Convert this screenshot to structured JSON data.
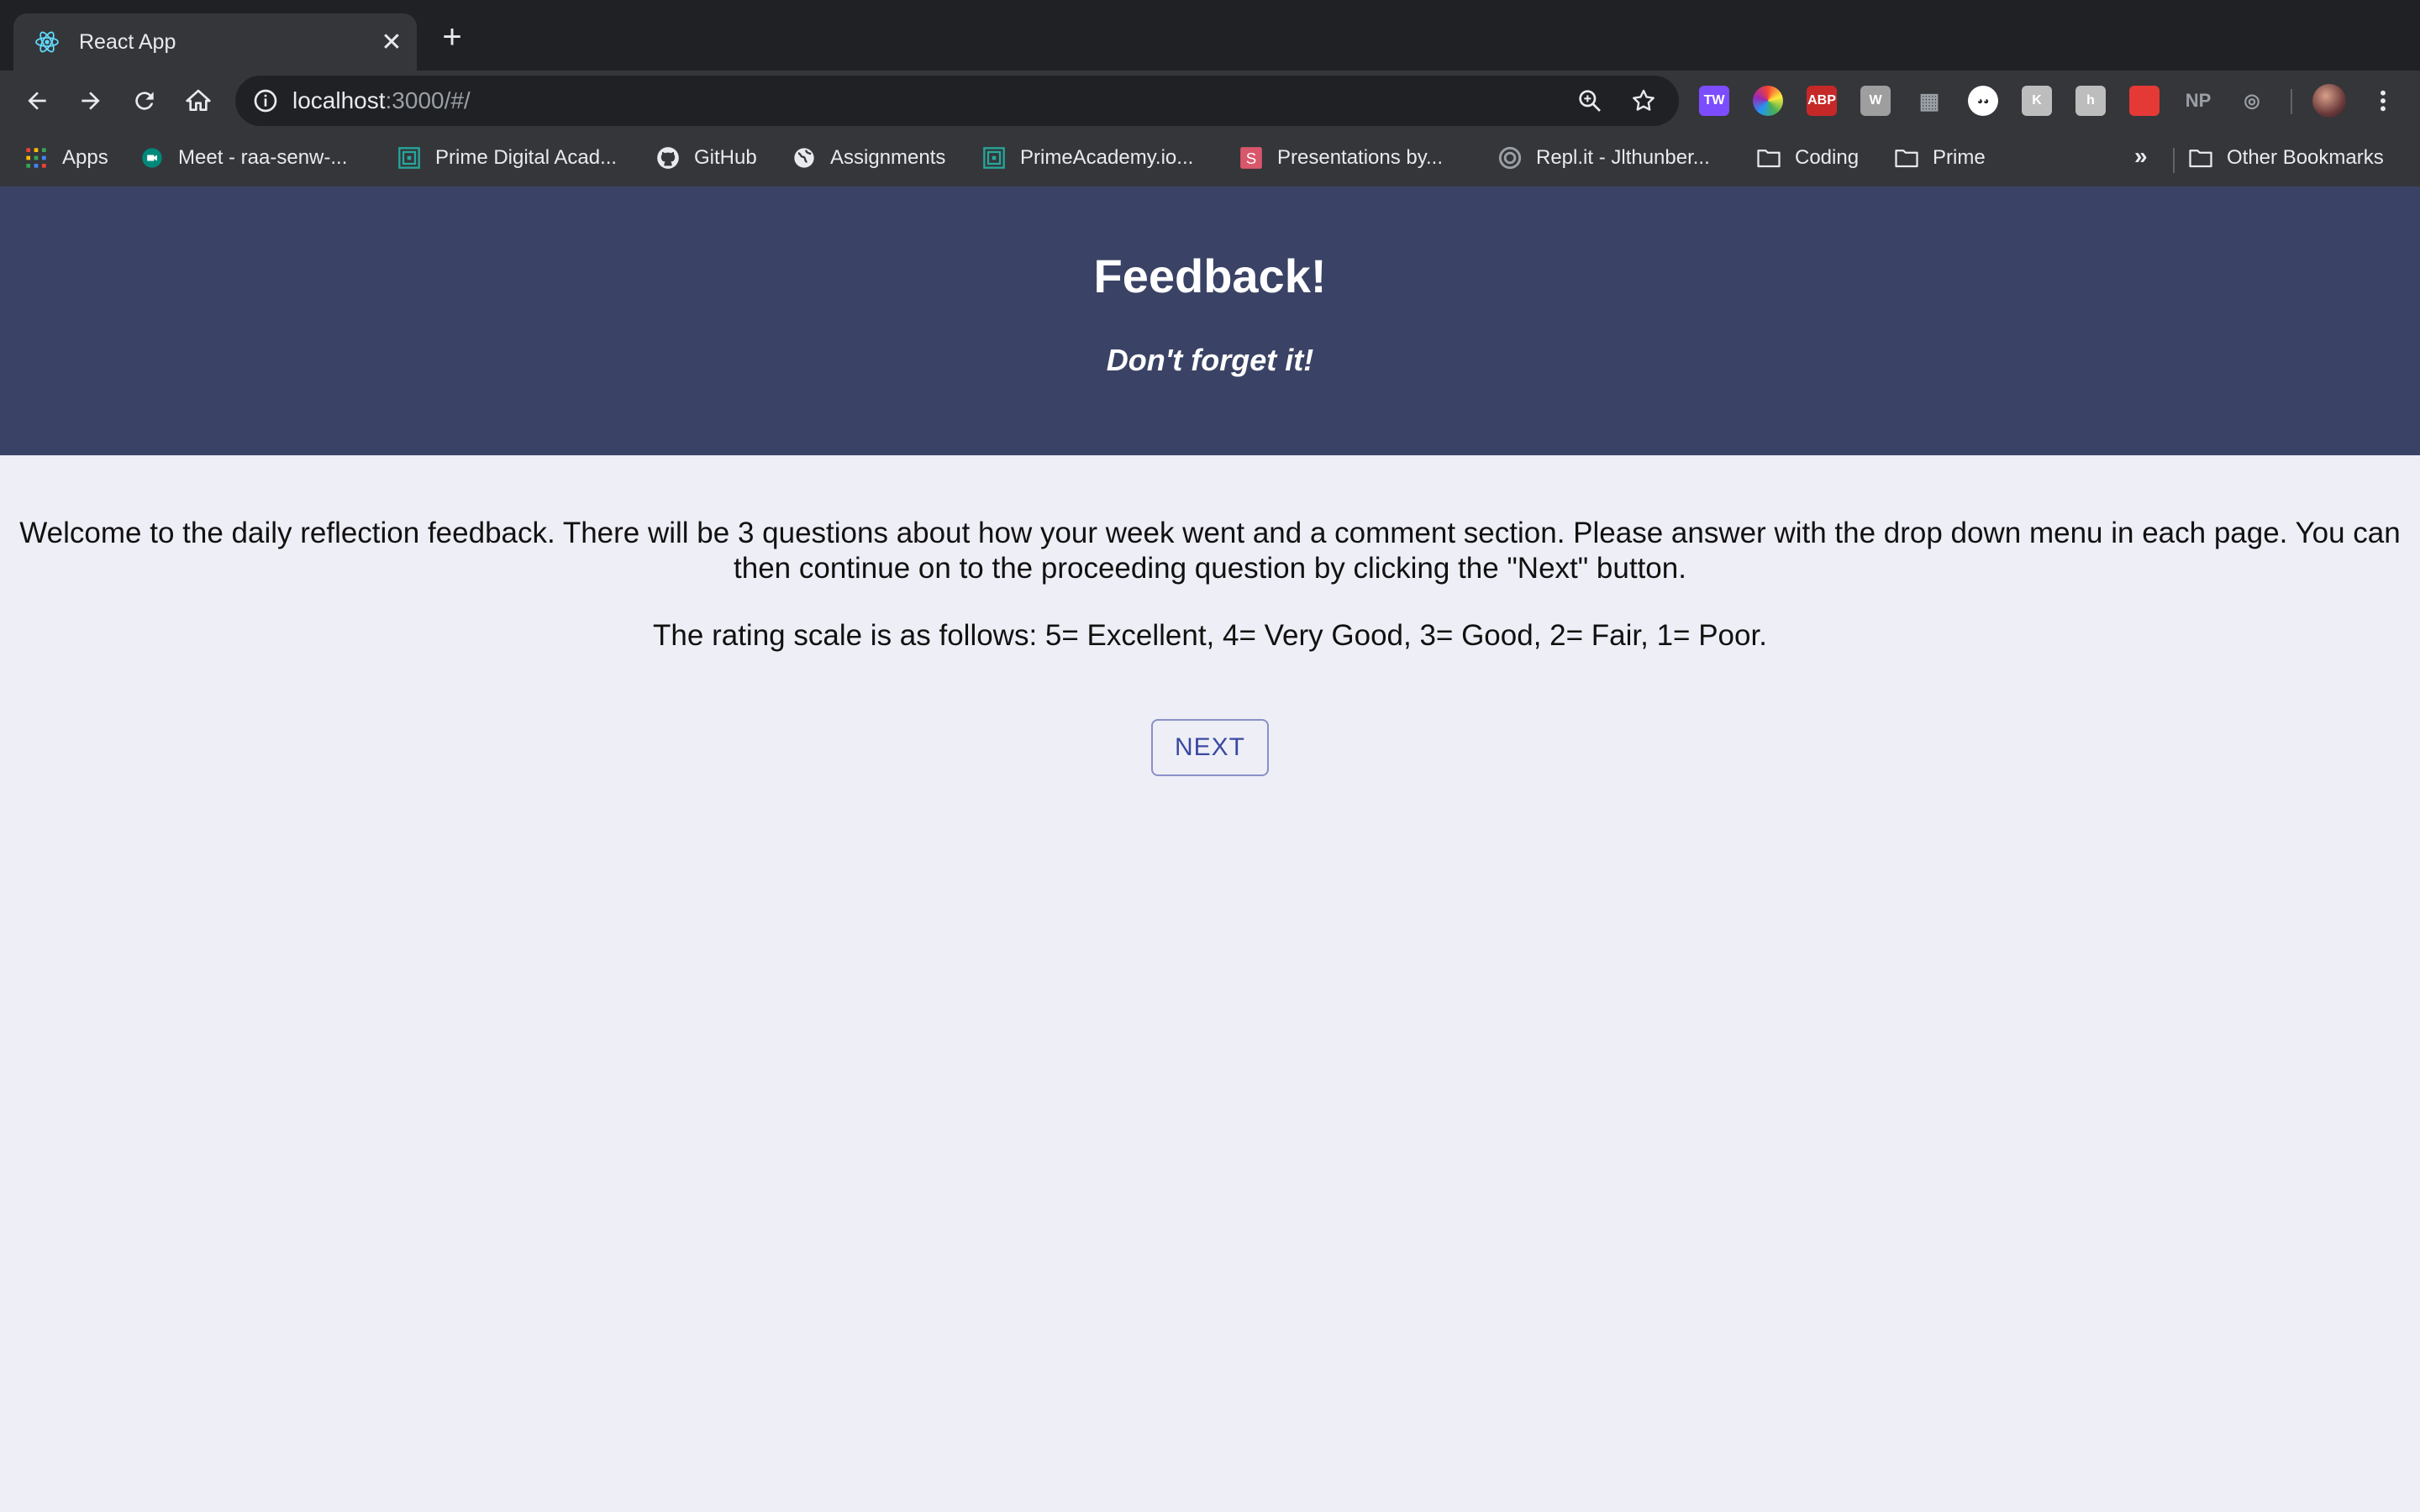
{
  "browser": {
    "tab_title": "React App",
    "tab_close": "✕",
    "new_tab": "+",
    "url_host": "localhost",
    "url_rest": ":3000/#/",
    "extensions": [
      {
        "name": "tw-extension-icon",
        "label": "TW",
        "color": "#7c4dff"
      },
      {
        "name": "color-wheel-extension-icon",
        "label": "",
        "color": "#ff9800"
      },
      {
        "name": "adblock-plus-icon",
        "label": "ABP",
        "color": "#c62828"
      },
      {
        "name": "w-extension-icon",
        "label": "W",
        "color": "#9e9e9e"
      },
      {
        "name": "grid-extension-icon",
        "label": "",
        "color": "#5f6368"
      },
      {
        "name": "eyes-extension-icon",
        "label": "",
        "color": "#ffffff"
      },
      {
        "name": "k-extension-icon",
        "label": "K",
        "color": "#bdbdbd"
      },
      {
        "name": "h-extension-icon",
        "label": "h",
        "color": "#bdbdbd"
      },
      {
        "name": "red-extension-icon",
        "label": "",
        "color": "#e53935"
      },
      {
        "name": "np-extension-icon",
        "label": "NP",
        "color": "#35363a"
      },
      {
        "name": "target-extension-icon",
        "label": "",
        "color": "#35363a"
      }
    ],
    "bookmarks": [
      {
        "label": "Apps",
        "icon": "apps-grid-icon"
      },
      {
        "label": "Meet - raa-senw-...",
        "icon": "meet-icon"
      },
      {
        "label": "Prime Digital Acad...",
        "icon": "prime-icon"
      },
      {
        "label": "GitHub",
        "icon": "github-icon"
      },
      {
        "label": "Assignments",
        "icon": "globe-icon"
      },
      {
        "label": "PrimeAcademy.io...",
        "icon": "prime-icon"
      },
      {
        "label": "Presentations by...",
        "icon": "slides-icon"
      },
      {
        "label": "Repl.it - Jlthunber...",
        "icon": "replit-icon"
      },
      {
        "label": "Coding",
        "icon": "folder-icon"
      },
      {
        "label": "Prime",
        "icon": "folder-icon"
      }
    ],
    "bookmarks_more": "»",
    "other_bookmarks": "Other Bookmarks"
  },
  "page": {
    "title": "Feedback!",
    "subtitle": "Don't forget it!",
    "intro": "Welcome to the daily reflection feedback. There will be 3 questions about how your week went and a comment section. Please answer with the drop down menu in each page. You can then continue on to the proceeding question by clicking the \"Next\" button.",
    "scale": "The rating scale is as follows: 5= Excellent, 4= Very Good, 3= Good, 2= Fair, 1= Poor.",
    "next_label": "NEXT"
  },
  "colors": {
    "header_bg": "#3a4365",
    "page_bg": "#eeeef7",
    "button_text": "#3a4aa0"
  }
}
